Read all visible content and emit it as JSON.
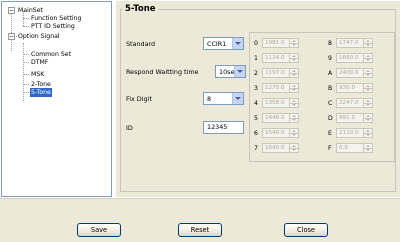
{
  "tree": {
    "items": [
      {
        "label": "MainSet",
        "expander": "−"
      },
      {
        "label": "Function Setting"
      },
      {
        "label": "PTT ID Setting"
      },
      {
        "label": "Option Signal",
        "expander": "−"
      },
      {
        "label": "Common Set"
      },
      {
        "label": "DTMF"
      },
      {
        "label": "MSK"
      },
      {
        "label": "2-Tone"
      },
      {
        "label": "5-Tone"
      }
    ]
  },
  "panel": {
    "title": "5-Tone",
    "standard": {
      "label": "Standard",
      "value": "CCIR1"
    },
    "respond": {
      "label": "Respond Waitting time",
      "value": "10sec"
    },
    "fix_digit": {
      "label": "Fix Digit",
      "value": "8"
    },
    "id": {
      "label": "ID",
      "value": "12345"
    },
    "freqs_left": [
      {
        "key": "0",
        "value": "1981.0"
      },
      {
        "key": "1",
        "value": "1124.0"
      },
      {
        "key": "2",
        "value": "1197.0"
      },
      {
        "key": "3",
        "value": "1275.0"
      },
      {
        "key": "4",
        "value": "1358.0"
      },
      {
        "key": "5",
        "value": "1446.0"
      },
      {
        "key": "6",
        "value": "1540.0"
      },
      {
        "key": "7",
        "value": "1640.0"
      }
    ],
    "freqs_right": [
      {
        "key": "8",
        "value": "1747.0"
      },
      {
        "key": "9",
        "value": "1860.0"
      },
      {
        "key": "A",
        "value": "2400.0"
      },
      {
        "key": "B",
        "value": "930.0"
      },
      {
        "key": "C",
        "value": "2247.0"
      },
      {
        "key": "D",
        "value": "991.0"
      },
      {
        "key": "E",
        "value": "2110.0"
      },
      {
        "key": "F",
        "value": "0.0"
      }
    ]
  },
  "buttons": {
    "save": "Save",
    "reset": "Reset",
    "close": "Close"
  }
}
